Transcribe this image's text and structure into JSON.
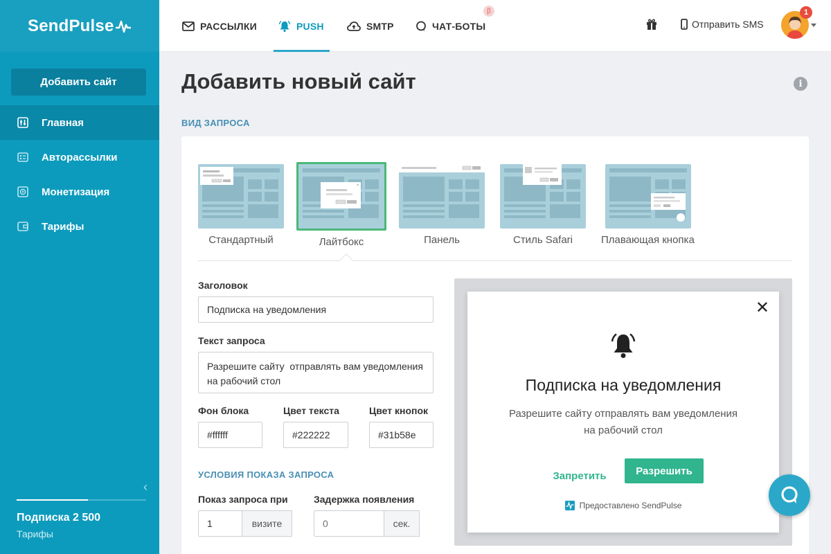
{
  "brand": {
    "name": "SendPulse"
  },
  "sidebar": {
    "add_site_label": "Добавить сайт",
    "items": [
      {
        "label": "Главная",
        "icon": "sliders-icon",
        "active": true
      },
      {
        "label": "Авторассылки",
        "icon": "automation-icon"
      },
      {
        "label": "Монетизация",
        "icon": "monetization-icon"
      },
      {
        "label": "Тарифы",
        "icon": "wallet-icon"
      }
    ],
    "subscription": {
      "name": "Подписка 2 500",
      "link": "Тарифы",
      "progress_fraction": 0.55
    }
  },
  "topbar": {
    "tabs": [
      {
        "label": "РАССЫЛКИ",
        "icon": "envelope-icon"
      },
      {
        "label": "PUSH",
        "icon": "bell-icon",
        "active": true
      },
      {
        "label": "SMTP",
        "icon": "cloud-icon"
      },
      {
        "label": "ЧАТ-БОТЫ",
        "icon": "chat-bubble-icon",
        "badge": "β"
      }
    ],
    "sms_label": "Отправить SMS",
    "notification_count": "1"
  },
  "page": {
    "title": "Добавить новый сайт",
    "request_type_label": "ВИД ЗАПРОСА",
    "types": [
      {
        "label": "Стандартный"
      },
      {
        "label": "Лайтбокс",
        "selected": true
      },
      {
        "label": "Панель"
      },
      {
        "label": "Стиль Safari"
      },
      {
        "label": "Плавающая кнопка"
      }
    ]
  },
  "form": {
    "title_label": "Заголовок",
    "title_value": "Подписка на уведомления",
    "text_label": "Текст запроса",
    "text_value": "Разрешите сайту  отправлять вам уведомления на рабочий стол",
    "bg_label": "Фон блока",
    "bg_value": "#ffffff",
    "text_color_label": "Цвет текста",
    "text_color_value": "#222222",
    "button_color_label": "Цвет кнопок",
    "button_color_value": "#31b58e",
    "conditions_label": "УСЛОВИЯ ПОКАЗА ЗАПРОСА",
    "show_on_label": "Показ запроса при",
    "show_on_value": "1",
    "show_on_unit": "визите",
    "delay_label": "Задержка появления",
    "delay_placeholder": "0",
    "delay_unit": "сек."
  },
  "preview": {
    "title": "Подписка на уведомления",
    "text": "Разрешите сайту отправлять вам уведомления на рабочий стол",
    "deny_label": "Запретить",
    "allow_label": "Разрешить",
    "powered_by": "Предоставлено SendPulse",
    "button_color": "#31b58e"
  },
  "colors": {
    "sidebar": "#0d9bbd",
    "accent": "#2ba7c8",
    "selected": "#4ab877"
  }
}
